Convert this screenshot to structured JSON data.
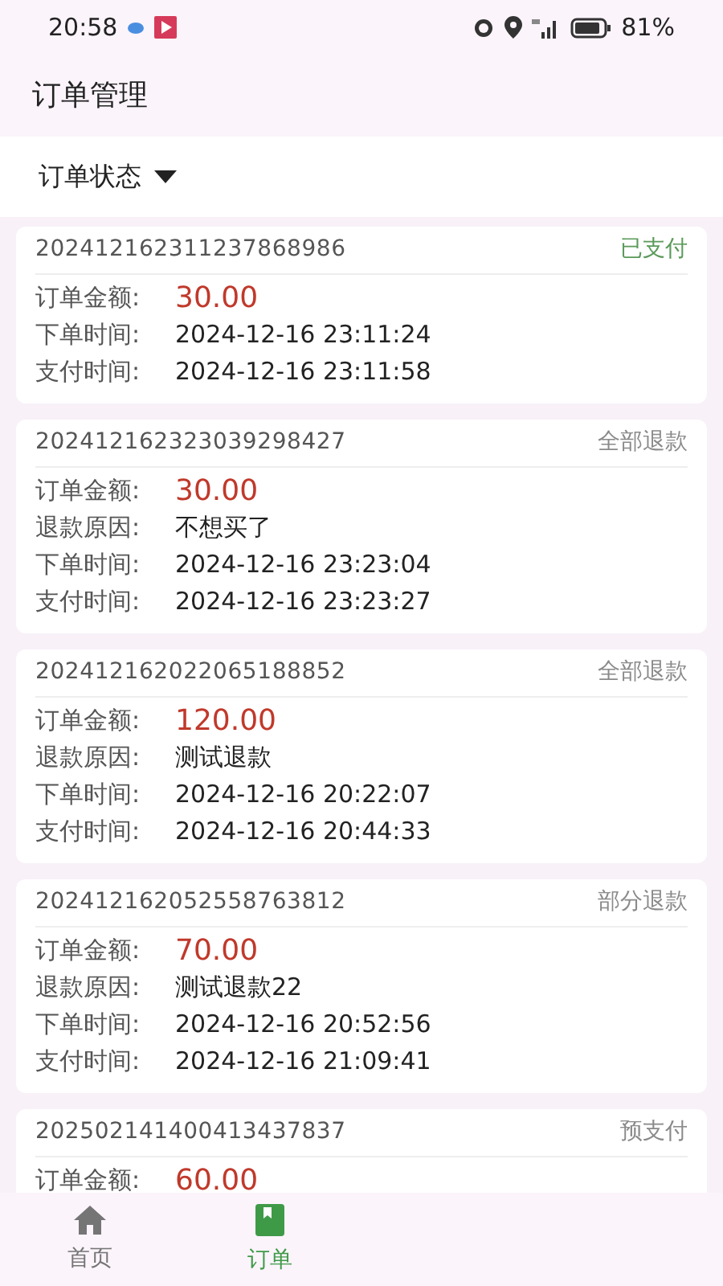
{
  "status_bar": {
    "time": "20:58",
    "battery": "81%"
  },
  "app_bar": {
    "title": "订单管理"
  },
  "filter": {
    "label": "订单状态"
  },
  "orders": [
    {
      "id": "202412162311237868986",
      "status": {
        "text": "已支付",
        "kind": "paid"
      },
      "rows": [
        {
          "label": "订单金额:",
          "value": "30.00",
          "kind": "amount"
        },
        {
          "label": "下单时间:",
          "value": "2024-12-16 23:11:24",
          "kind": "text"
        },
        {
          "label": "支付时间:",
          "value": "2024-12-16 23:11:58",
          "kind": "text"
        }
      ]
    },
    {
      "id": "202412162323039298427",
      "status": {
        "text": "全部退款",
        "kind": "other"
      },
      "rows": [
        {
          "label": "订单金额:",
          "value": "30.00",
          "kind": "amount"
        },
        {
          "label": "退款原因:",
          "value": "不想买了",
          "kind": "text"
        },
        {
          "label": "下单时间:",
          "value": "2024-12-16 23:23:04",
          "kind": "text"
        },
        {
          "label": "支付时间:",
          "value": "2024-12-16 23:23:27",
          "kind": "text"
        }
      ]
    },
    {
      "id": "202412162022065188852",
      "status": {
        "text": "全部退款",
        "kind": "other"
      },
      "rows": [
        {
          "label": "订单金额:",
          "value": "120.00",
          "kind": "amount"
        },
        {
          "label": "退款原因:",
          "value": "测试退款",
          "kind": "text"
        },
        {
          "label": "下单时间:",
          "value": "2024-12-16 20:22:07",
          "kind": "text"
        },
        {
          "label": "支付时间:",
          "value": "2024-12-16 20:44:33",
          "kind": "text"
        }
      ]
    },
    {
      "id": "202412162052558763812",
      "status": {
        "text": "部分退款",
        "kind": "other"
      },
      "rows": [
        {
          "label": "订单金额:",
          "value": "70.00",
          "kind": "amount"
        },
        {
          "label": "退款原因:",
          "value": "测试退款22",
          "kind": "text"
        },
        {
          "label": "下单时间:",
          "value": "2024-12-16 20:52:56",
          "kind": "text"
        },
        {
          "label": "支付时间:",
          "value": "2024-12-16 21:09:41",
          "kind": "text"
        }
      ]
    },
    {
      "id": "202502141400413437837",
      "status": {
        "text": "预支付",
        "kind": "other"
      },
      "rows": [
        {
          "label": "订单金额:",
          "value": "60.00",
          "kind": "amount"
        }
      ]
    }
  ],
  "nav": [
    {
      "label": "首页",
      "kind": "home",
      "selected": false
    },
    {
      "label": "订单",
      "kind": "orders",
      "selected": true
    }
  ]
}
